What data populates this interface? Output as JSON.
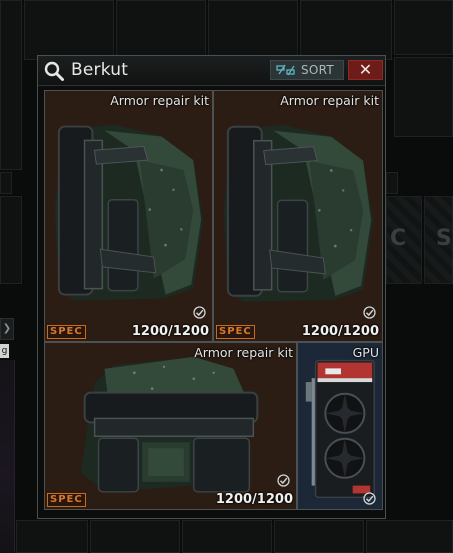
{
  "container": {
    "title": "Berkut",
    "sort_label": "SORT",
    "close_label": "✕"
  },
  "items": [
    {
      "name": "Armor repair kit",
      "durability": "1200/1200",
      "badge": "SPEC",
      "checked": true
    },
    {
      "name": "Armor repair kit",
      "durability": "1200/1200",
      "badge": "SPEC",
      "checked": true
    },
    {
      "name": "Armor repair kit",
      "durability": "1200/1200",
      "badge": "SPEC",
      "checked": true
    },
    {
      "name": "GPU",
      "checked": true
    }
  ],
  "background": {
    "side_tag": "❯",
    "side_tag2": "g",
    "ghost_letters": [
      "C",
      "S"
    ]
  },
  "colors": {
    "close_button": "#6e1c1a",
    "sort_button": "#2b3536",
    "item_background": "#2a1d14",
    "gpu_background": "#1c2838",
    "spec_badge": "#c86b1f"
  },
  "icons": {
    "search": "search-icon",
    "sort": "sort-icon",
    "close": "close-icon",
    "checkmark": "checkmark-icon"
  }
}
